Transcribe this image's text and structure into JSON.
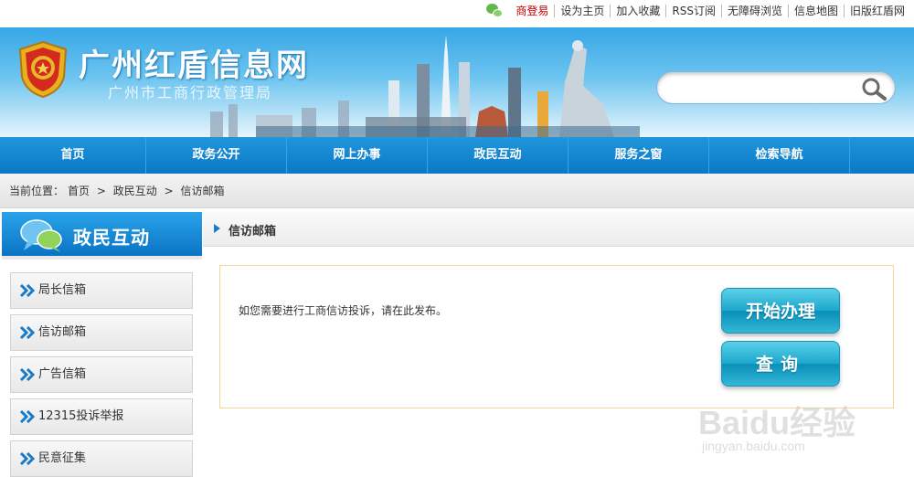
{
  "top_links": {
    "wechat_icon": "wechat-icon",
    "items": [
      "商登易",
      "设为主页",
      "加入收藏",
      "RSS订阅",
      "无障碍浏览",
      "信息地图",
      "旧版红盾网"
    ]
  },
  "banner": {
    "title": "广州红盾信息网",
    "subtitle": "广州市工商行政管理局",
    "search_placeholder": "",
    "search_icon": "magnifier-icon"
  },
  "nav": [
    "首页",
    "政务公开",
    "网上办事",
    "政民互动",
    "服务之窗",
    "检索导航"
  ],
  "breadcrumb": {
    "prefix": "当前位置：",
    "items": [
      "首页",
      "政民互动",
      "信访邮箱"
    ],
    "separator": ">"
  },
  "sidebar": {
    "title": "政民互动",
    "items": [
      "局长信箱",
      "信访邮箱",
      "广告信箱",
      "12315投诉举报",
      "民意征集"
    ]
  },
  "main": {
    "title": "信访邮箱",
    "description": "如您需要进行工商信访投诉，请在此发布。",
    "start_button": "开始办理",
    "query_button": "查询"
  },
  "watermark": {
    "brand": "Baidu经验",
    "url": "jingyan.baidu.com"
  },
  "colors": {
    "nav_blue": "#0b78c6",
    "button_cyan": "#1ba7cc",
    "highlight_red": "#c40000"
  }
}
